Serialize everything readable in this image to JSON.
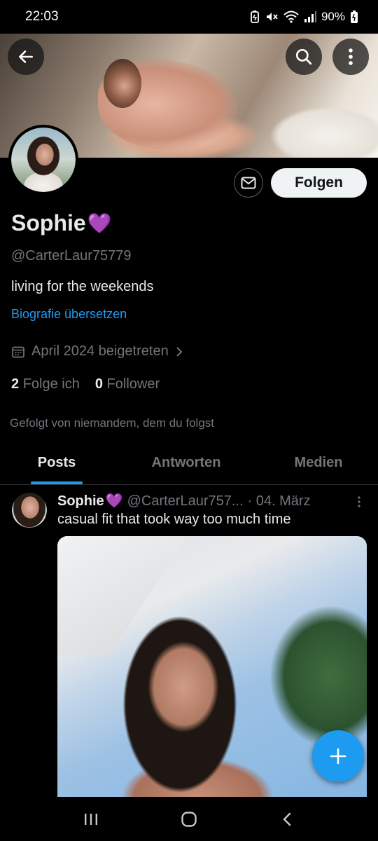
{
  "status_bar": {
    "time": "22:03",
    "battery": "90%",
    "icons": [
      "battery-saver-icon",
      "mute-icon",
      "wifi-icon",
      "signal-icon",
      "battery-icon"
    ]
  },
  "header": {
    "back_icon": "arrow-left-icon",
    "search_icon": "search-icon",
    "more_icon": "more-vertical-icon"
  },
  "profile": {
    "name": "Sophie",
    "name_emoji": "💜",
    "handle": "@CarterLaur75779",
    "bio": "living for the weekends",
    "translate_link": "Biografie übersetzen",
    "joined": "April 2024 beigetreten",
    "following_count": "2",
    "following_label": "Folge ich",
    "followers_count": "0",
    "followers_label": "Follower",
    "followed_by_text": "Gefolgt von niemandem, dem du folgst",
    "follow_button": "Folgen"
  },
  "tabs": [
    {
      "label": "Posts",
      "active": true
    },
    {
      "label": "Antworten",
      "active": false
    },
    {
      "label": "Medien",
      "active": false
    }
  ],
  "post": {
    "author": "Sophie",
    "author_emoji": "💜",
    "handle": "@CarterLaur757...",
    "date": "· 04. März",
    "text": "casual fit that took way too much time"
  },
  "colors": {
    "accent": "#1d9bf0",
    "background": "#000000",
    "secondary_text": "#71767b",
    "heart": "#b44bf0"
  }
}
